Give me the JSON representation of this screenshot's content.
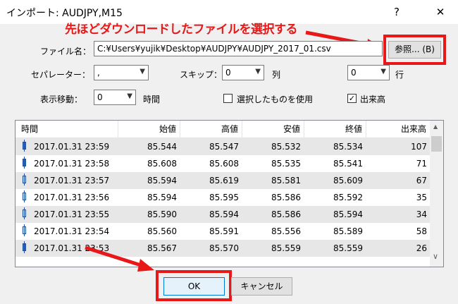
{
  "window": {
    "title": "インポート: AUDJPY,M15",
    "help": "?",
    "close": "✕"
  },
  "annotation": "先ほどダウンロードしたファイルを選択する",
  "file": {
    "label": "ファイル名：",
    "value": "C:¥Users¥yujik¥Desktop¥AUDJPY¥AUDJPY_2017_01.csv",
    "browse": "参照... (B)"
  },
  "separator": {
    "label": "セパレーター：",
    "value": ","
  },
  "skip": {
    "label": "スキップ：",
    "value": "0",
    "col_label": "列",
    "row_value": "0",
    "row_label": "行"
  },
  "shift": {
    "label": "表示移動：",
    "value": "0",
    "unit": "時間"
  },
  "use_selected": {
    "label": "選択したものを使用",
    "checked": false
  },
  "volume": {
    "label": "出来高",
    "checked": true,
    "mark": "✓"
  },
  "table": {
    "columns": [
      "時間",
      "始値",
      "高値",
      "安値",
      "終値",
      "出来高"
    ],
    "rows": [
      [
        "2017.01.31 23:59",
        "85.544",
        "85.547",
        "85.532",
        "85.534",
        "107"
      ],
      [
        "2017.01.31 23:58",
        "85.608",
        "85.608",
        "85.535",
        "85.541",
        "71"
      ],
      [
        "2017.01.31 23:57",
        "85.594",
        "85.619",
        "85.581",
        "85.609",
        "67"
      ],
      [
        "2017.01.31 23:56",
        "85.594",
        "85.595",
        "85.586",
        "85.592",
        "35"
      ],
      [
        "2017.01.31 23:55",
        "85.590",
        "85.594",
        "85.586",
        "85.594",
        "34"
      ],
      [
        "2017.01.31 23:54",
        "85.560",
        "85.591",
        "85.556",
        "85.589",
        "58"
      ],
      [
        "2017.01.31 23:53",
        "85.567",
        "85.570",
        "85.559",
        "85.559",
        "26"
      ]
    ],
    "scroll_up": "▲",
    "scroll_down": "∨"
  },
  "ok_label": "OK",
  "cancel_label": "キャンセル",
  "accent": "#e81818"
}
